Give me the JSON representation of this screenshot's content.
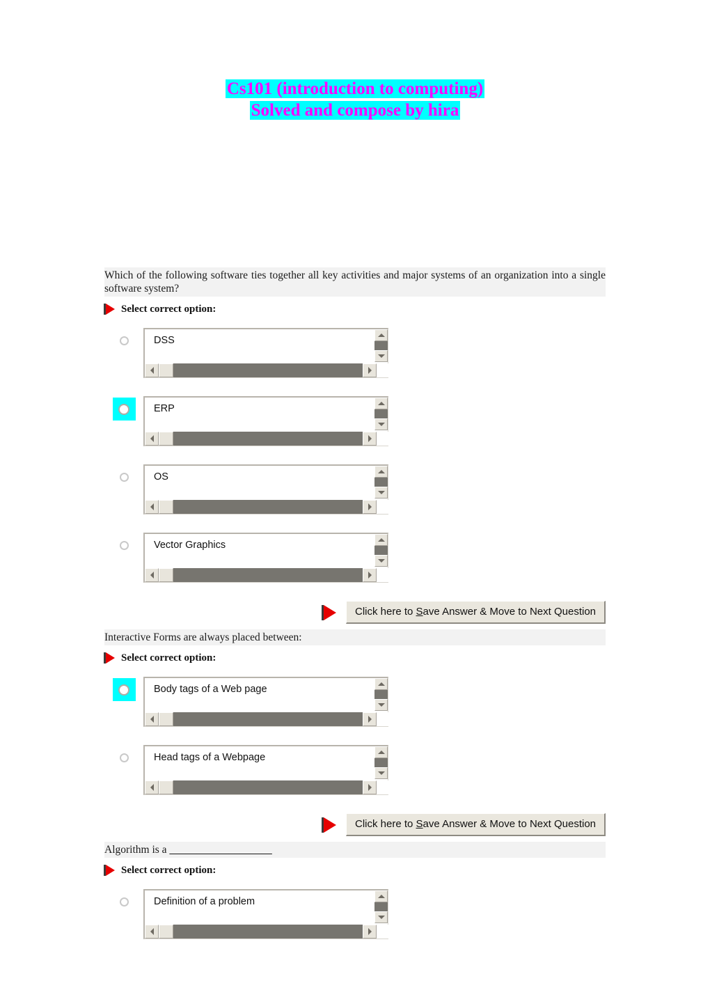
{
  "title": {
    "line1": "Cs101 (introduction to computing)",
    "line2": "Solved and compose by hira",
    "text_color": "#ff00ff",
    "highlight_color": "#00ffff"
  },
  "labels": {
    "select_option": "Select correct option:",
    "save_button_prefix": "Click here to ",
    "save_button_accel": "S",
    "save_button_suffix": "ave Answer & Move to Next Question"
  },
  "selected_color": "#00ffff",
  "questions": [
    {
      "text": "Which of the following software ties together all key activities and major systems of an organization into a single software system?",
      "options": [
        {
          "label": "DSS",
          "selected": false
        },
        {
          "label": "ERP",
          "selected": true
        },
        {
          "label": "OS",
          "selected": false
        },
        {
          "label": "Vector Graphics",
          "selected": false
        }
      ],
      "has_save_button": true
    },
    {
      "text": "Interactive Forms are always placed between:",
      "options": [
        {
          "label": "Body tags of a Web page",
          "selected": true
        },
        {
          "label": "Head tags of a Webpage",
          "selected": false
        }
      ],
      "has_save_button": true
    },
    {
      "text": "Algorithm is a ",
      "blank": "___________________",
      "options": [
        {
          "label": "Definition of a problem",
          "selected": false
        }
      ],
      "has_save_button": false
    }
  ]
}
